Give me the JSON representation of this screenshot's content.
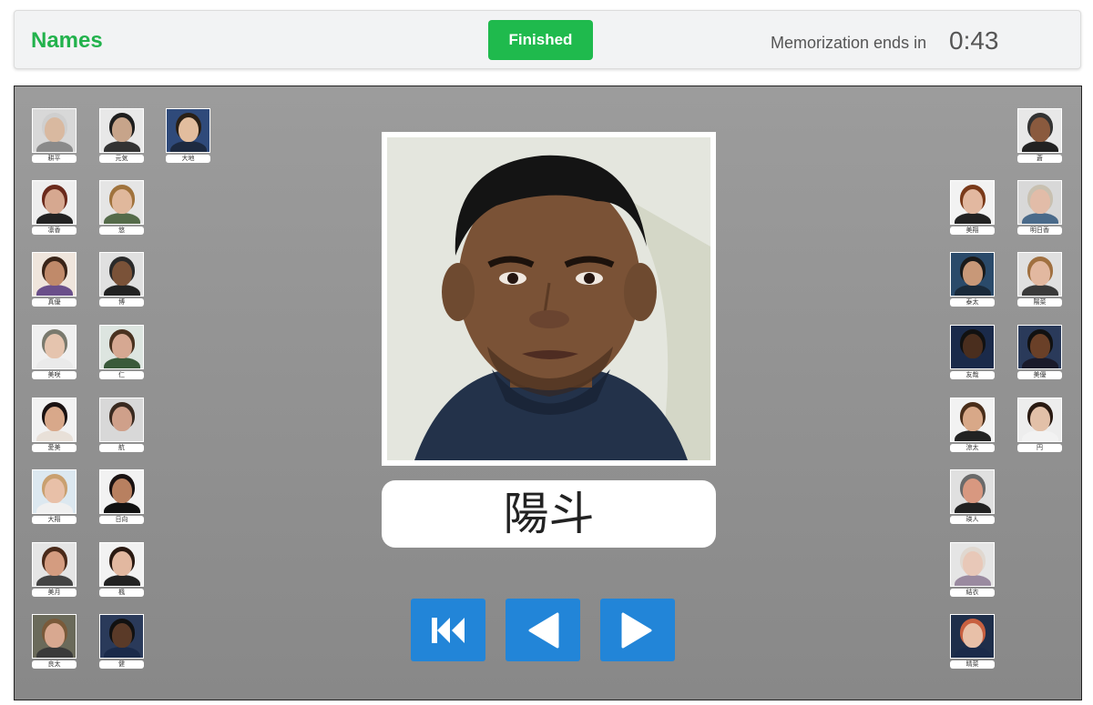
{
  "header": {
    "title": "Names",
    "finish_label": "Finished",
    "timer_label": "Memorization ends in",
    "timer_value": "0:43"
  },
  "current": {
    "name": "陽斗"
  },
  "thumbnails_left": [
    {
      "label": "耕平",
      "bg": "#d8d8d8",
      "skin": "#d9b9a0",
      "hair": "#cfcfcf",
      "shirt": "#8a8a8a"
    },
    {
      "label": "元気",
      "bg": "#e8e8e8",
      "skin": "#c7a48a",
      "hair": "#1e1e1e",
      "shirt": "#333333"
    },
    {
      "label": "大地",
      "bg": "#2f4a7a",
      "skin": "#e2bd9e",
      "hair": "#2a2016",
      "shirt": "#1d2a40"
    },
    {
      "label": "凛香",
      "bg": "#eeeeee",
      "skin": "#d6a890",
      "hair": "#6b2a1c",
      "shirt": "#222222"
    },
    {
      "label": "悠",
      "bg": "#e5e5e5",
      "skin": "#e0b89c",
      "hair": "#a0733d",
      "shirt": "#556b4a"
    },
    {
      "label": "真優",
      "bg": "#efe5dc",
      "skin": "#c08a6a",
      "hair": "#3a2418",
      "shirt": "#6a4f8a"
    },
    {
      "label": "博",
      "bg": "#e0e0e0",
      "skin": "#7a5238",
      "hair": "#2a2a2a",
      "shirt": "#222222"
    },
    {
      "label": "美咲",
      "bg": "#f0f0f0",
      "skin": "#e5c4ae",
      "hair": "#7a7a6e",
      "shirt": "#eaeaea"
    },
    {
      "label": "仁",
      "bg": "#dde5e0",
      "skin": "#d6a892",
      "hair": "#4a3220",
      "shirt": "#3a5a3a"
    },
    {
      "label": "愛美",
      "bg": "#f2f2f2",
      "skin": "#d8a88a",
      "hair": "#1a1212",
      "shirt": "#e8e0d8"
    },
    {
      "label": "航",
      "bg": "#d8d8d8",
      "skin": "#cfa08a",
      "hair": "#3a2a20",
      "shirt": "#d8d8d8"
    },
    {
      "label": "大翔",
      "bg": "#dce8f0",
      "skin": "#e8c0a8",
      "hair": "#c9a070",
      "shirt": "#f0f0f0"
    },
    {
      "label": "日向",
      "bg": "#f2f2f2",
      "skin": "#b88060",
      "hair": "#1a1212",
      "shirt": "#111111"
    },
    {
      "label": "美月",
      "bg": "#e5e5e5",
      "skin": "#d49c80",
      "hair": "#4a2a1a",
      "shirt": "#444444"
    },
    {
      "label": "楓",
      "bg": "#f2f2f2",
      "skin": "#e2b8a0",
      "hair": "#2a1a12",
      "shirt": "#222222"
    },
    {
      "label": "良太",
      "bg": "#6a6a5a",
      "skin": "#d8a890",
      "hair": "#7a5a3a",
      "shirt": "#3a3a3a"
    },
    {
      "label": "健",
      "bg": "#2a3a5a",
      "skin": "#5a3a28",
      "hair": "#111111",
      "shirt": "#1a2a4a"
    }
  ],
  "thumbnails_right": [
    {
      "label": "蒼",
      "bg": "#e8e8e8",
      "skin": "#8a5a3e",
      "hair": "#333333",
      "shirt": "#222222"
    },
    {
      "label": "美翔",
      "bg": "#f2f2f2",
      "skin": "#e2b8a0",
      "hair": "#7a3a1a",
      "shirt": "#222222"
    },
    {
      "label": "明日香",
      "bg": "#d8d8d8",
      "skin": "#e2bca8",
      "hair": "#c8c0b0",
      "shirt": "#4a6a8a"
    },
    {
      "label": "泰太",
      "bg": "#2a4a6a",
      "skin": "#c89878",
      "hair": "#1a1a1a",
      "shirt": "#1a2a3a"
    },
    {
      "label": "陽菜",
      "bg": "#e0e0e0",
      "skin": "#e2b8a0",
      "hair": "#a07040",
      "shirt": "#3a3a3a"
    },
    {
      "label": "友哉",
      "bg": "#1a2a4a",
      "skin": "#4a2e1e",
      "hair": "#111111",
      "shirt": "#1a2a4a"
    },
    {
      "label": "美優",
      "bg": "#2a3a5a",
      "skin": "#6a4028",
      "hair": "#111111",
      "shirt": "#1a1a2a"
    },
    {
      "label": "涼太",
      "bg": "#f2f2f2",
      "skin": "#d8a888",
      "hair": "#4a2e1a",
      "shirt": "#222222"
    },
    {
      "label": "円",
      "bg": "#ededed",
      "skin": "#e2c0a8",
      "hair": "#2a1a12",
      "shirt": "#f2f2f2"
    },
    {
      "label": "瑛人",
      "bg": "#e0e0e0",
      "skin": "#d89880",
      "hair": "#6a6a6a",
      "shirt": "#222222"
    },
    {
      "label": "結衣",
      "bg": "#e5e5e5",
      "skin": "#e8c8b8",
      "hair": "#e0d8d0",
      "shirt": "#9a8aa0"
    },
    {
      "label": "晴菜",
      "bg": "#1e2e4a",
      "skin": "#e8c0a8",
      "hair": "#c86040",
      "shirt": "#1a2a4a"
    }
  ],
  "nav": {
    "first_icon": "skip-to-start-icon",
    "prev_icon": "triangle-left-icon",
    "next_icon": "triangle-right-icon"
  },
  "colors": {
    "accent_green": "#22b24c",
    "button_green": "#1fba4d",
    "nav_blue": "#2285d8"
  }
}
